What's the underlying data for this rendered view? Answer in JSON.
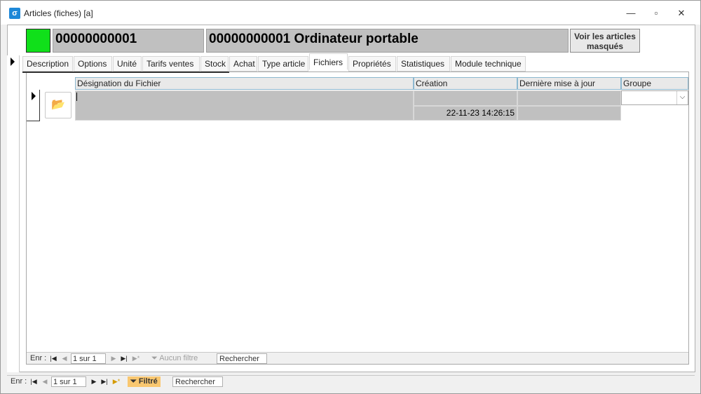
{
  "window": {
    "title": "Articles (fiches) [a]",
    "icons": {
      "app": "access-form-icon",
      "minimize": "minimize-icon",
      "maximize": "maximize-icon",
      "close": "close-icon"
    }
  },
  "header": {
    "status_color": "#10e01a",
    "code": "00000000001",
    "name": "00000000001 Ordinateur portable",
    "show_hidden_button": "Voir les articles masqués"
  },
  "tabs": [
    {
      "label": "Description"
    },
    {
      "label": "Options"
    },
    {
      "label": "Unité"
    },
    {
      "label": "Tarifs ventes"
    },
    {
      "label": "Stock"
    },
    {
      "label": "Achat"
    },
    {
      "label": "Type article"
    },
    {
      "label": "Fichiers",
      "active": true
    },
    {
      "label": "Propriétés"
    },
    {
      "label": "Statistiques"
    },
    {
      "label": "Module technique"
    }
  ],
  "files_grid": {
    "headers": {
      "designation": "Désignation du Fichier",
      "creation": "Création",
      "last_update": "Dernière mise à jour",
      "group": "Groupe"
    },
    "row": {
      "designation": "",
      "creation": "22-11-23 14:26:15",
      "last_update": "",
      "group": ""
    },
    "folder_icon": "open-folder-icon"
  },
  "sub_nav": {
    "label": "Enr :",
    "current": "1 sur 1",
    "filter": "Aucun filtre",
    "search": "Rechercher"
  },
  "main_nav": {
    "label": "Enr :",
    "current": "1 sur 1",
    "filter": "Filtré",
    "search": "Rechercher"
  }
}
